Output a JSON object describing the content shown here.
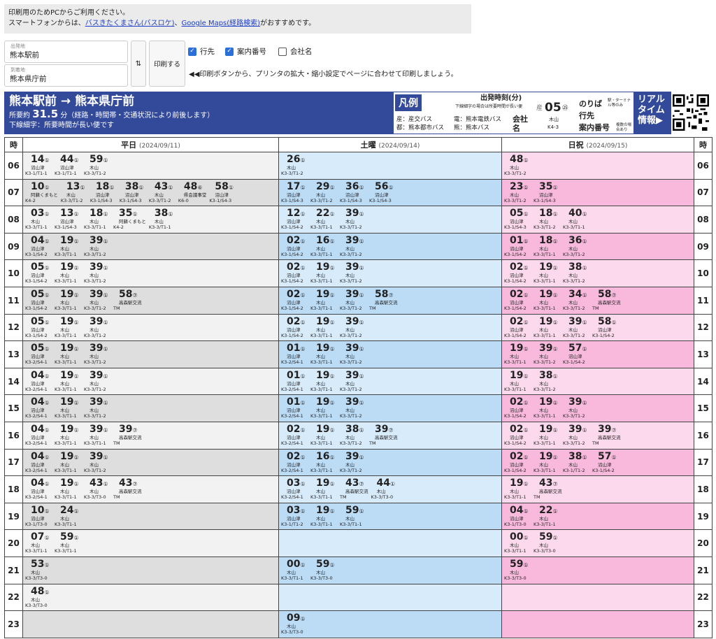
{
  "notice": {
    "line1": "印刷用のためPCからご利用ください。",
    "line2_pre": "スマートフォンからは、",
    "link1": "バスきたくまさん(バスロケ)",
    "sep": "、",
    "link2": "Google Maps(経路検索)",
    "line2_post": "がおすすめです。"
  },
  "from": {
    "label": "出発地",
    "value": "熊本駅前"
  },
  "to": {
    "label": "到着地",
    "value": "熊本県庁前"
  },
  "swap_label": "⇅",
  "print_label": "印刷する",
  "options": [
    {
      "label": "行先",
      "checked": true
    },
    {
      "label": "案内番号",
      "checked": true
    },
    {
      "label": "会社名",
      "checked": false
    }
  ],
  "hint": "◀◀印刷ボタンから、プリンタの拡大・縮小設定でページに合わせて印刷しましょう。",
  "route": {
    "title": "熊本駅前 → 熊本県庁前",
    "dur_pre": "所要約",
    "dur_val": "31.5",
    "dur_post": "分（経路・時間帯・交通状況により前後します）",
    "note": "下線細字：所要時間が長い便です"
  },
  "legend": {
    "tag": "凡例",
    "company1": "産：産交バス",
    "company2": "都：熊本都市バス",
    "company3": "電：熊本電鉄バス",
    "company4": "熊：熊本バス",
    "departure": "出発時刻(分)",
    "departure_note": "下線細字の場合は所要時間が長い便",
    "sample_co": "産",
    "sample_min": "05",
    "sample_stop": "㉕",
    "sample_dest": "木山",
    "sample_code": "K4-3",
    "k_company": "会社名",
    "k_stop": "のりば",
    "k_stop_note": "駅・ターミナル等のみ",
    "k_dest": "行先",
    "k_code": "案内番号",
    "k_code_note": "複数の場合あり"
  },
  "realtime": "リアルタイム情報▶",
  "headers": {
    "hour": "時",
    "weekday": "平日",
    "weekday_date": "(2024/09/11)",
    "saturday": "土曜",
    "saturday_date": "(2024/09/14)",
    "holiday": "日祝",
    "holiday_date": "(2024/09/15)"
  },
  "rows": [
    {
      "h": "06",
      "wd": [
        [
          "14",
          "①",
          "沼山津",
          "K3-1/T1-1"
        ],
        [
          "44",
          "①",
          "沼山津",
          "K3-1/T1-1"
        ],
        [
          "59",
          "①",
          "木山",
          "K3-3/T1-2"
        ]
      ],
      "sa": [
        [
          "26",
          "①",
          "木山",
          "K3-3/T1-2"
        ]
      ],
      "ho": [
        [
          "48",
          "①",
          "木山",
          "K3-3/T1-2"
        ]
      ]
    },
    {
      "h": "07",
      "wd": [
        [
          "10",
          "①",
          "阿蘇くまもと",
          "K4-2"
        ],
        [
          "13",
          "①",
          "木山",
          "K3-3/T1-2"
        ],
        [
          "18",
          "①",
          "沼山津",
          "K3-1/S4-3"
        ],
        [
          "38",
          "①",
          "沼山津",
          "K3-1/S4-3"
        ],
        [
          "43",
          "①",
          "木山",
          "K3-3/T1-2"
        ],
        [
          "48",
          "⑥",
          "県会議事堂",
          "K6-0"
        ],
        [
          "58",
          "①",
          "沼山津",
          "K3-1/S4-3"
        ]
      ],
      "sa": [
        [
          "17",
          "①",
          "沼山津",
          "K3-1/S4-3"
        ],
        [
          "29",
          "①",
          "木山",
          "K3-3/T1-2"
        ],
        [
          "36",
          "①",
          "沼山津",
          "K3-1/S4-3"
        ],
        [
          "56",
          "①",
          "沼山津",
          "K3-1/S4-3"
        ]
      ],
      "ho": [
        [
          "23",
          "①",
          "木山",
          "K3-3/T1-2"
        ],
        [
          "35",
          "①",
          "沼山津",
          "K3-1/S4-3"
        ]
      ]
    },
    {
      "h": "08",
      "wd": [
        [
          "03",
          "①",
          "木山",
          "K3-3/T1-1"
        ],
        [
          "13",
          "①",
          "沼山津",
          "K3-1/S4-3"
        ],
        [
          "18",
          "①",
          "木山",
          "K3-3/T1-1"
        ],
        [
          "35",
          "①",
          "阿蘇くまもと",
          "K4-2"
        ],
        [
          "38",
          "①",
          "木山",
          "K3-3/T1-1"
        ]
      ],
      "sa": [
        [
          "12",
          "①",
          "沼山津",
          "K3-1/S4-2"
        ],
        [
          "22",
          "①",
          "木山",
          "K3-3/T1-1"
        ],
        [
          "39",
          "①",
          "木山",
          "K3-3/T1-2"
        ]
      ],
      "ho": [
        [
          "05",
          "①",
          "沼山津",
          "K3-1/S4-3"
        ],
        [
          "18",
          "①",
          "木山",
          "K3-3/T1-2"
        ],
        [
          "40",
          "①",
          "木山",
          "K3-3/T1-1"
        ]
      ]
    },
    {
      "h": "09",
      "wd": [
        [
          "04",
          "①",
          "沼山津",
          "K3-1/S4-2"
        ],
        [
          "19",
          "①",
          "木山",
          "K3-3/T1-1"
        ],
        [
          "39",
          "①",
          "木山",
          "K3-3/T1-2"
        ]
      ],
      "sa": [
        [
          "02",
          "①",
          "沼山津",
          "K3-1/S4-2"
        ],
        [
          "16",
          "①",
          "木山",
          "K3-3/T1-1"
        ],
        [
          "39",
          "①",
          "木山",
          "K3-3/T1-2"
        ]
      ],
      "ho": [
        [
          "01",
          "①",
          "沼山津",
          "K3-1/S4-2"
        ],
        [
          "18",
          "①",
          "木山",
          "K3-3/T1-1"
        ],
        [
          "36",
          "①",
          "木山",
          "K3-3/T1-2"
        ]
      ]
    },
    {
      "h": "10",
      "wd": [
        [
          "05",
          "①",
          "沼山津",
          "K3-1/S4-2"
        ],
        [
          "19",
          "①",
          "木山",
          "K3-3/T1-1"
        ],
        [
          "39",
          "①",
          "木山",
          "K3-3/T1-2"
        ]
      ],
      "sa": [
        [
          "02",
          "①",
          "沼山津",
          "K3-1/S4-2"
        ],
        [
          "19",
          "①",
          "木山",
          "K3-3/T1-1"
        ],
        [
          "39",
          "①",
          "木山",
          "K3-3/T1-2"
        ]
      ],
      "ho": [
        [
          "02",
          "①",
          "沼山津",
          "K3-1/S4-2"
        ],
        [
          "19",
          "①",
          "木山",
          "K3-3/T1-1"
        ],
        [
          "38",
          "①",
          "木山",
          "K3-3/T1-2"
        ]
      ]
    },
    {
      "h": "11",
      "wd": [
        [
          "05",
          "①",
          "沼山津",
          "K3-1/S4-2"
        ],
        [
          "19",
          "①",
          "木山",
          "K3-3/T1-1"
        ],
        [
          "39",
          "①",
          "木山",
          "K3-3/T1-2"
        ],
        [
          "58",
          "⑦",
          "高森駅交流",
          "TM"
        ]
      ],
      "sa": [
        [
          "02",
          "①",
          "沼山津",
          "K3-1/S4-2"
        ],
        [
          "19",
          "①",
          "木山",
          "K3-3/T1-1"
        ],
        [
          "39",
          "①",
          "木山",
          "K3-3/T1-2"
        ],
        [
          "58",
          "⑦",
          "高森駅交流",
          "TM"
        ]
      ],
      "ho": [
        [
          "02",
          "①",
          "沼山津",
          "K3-1/S4-2"
        ],
        [
          "19",
          "①",
          "木山",
          "K3-3/T1-1"
        ],
        [
          "34",
          "①",
          "木山",
          "K3-3/T1-2"
        ],
        [
          "58",
          "⑦",
          "高森駅交流",
          "TM"
        ]
      ]
    },
    {
      "h": "12",
      "wd": [
        [
          "05",
          "①",
          "沼山津",
          "K3-1/S4-2"
        ],
        [
          "19",
          "①",
          "木山",
          "K3-3/T1-1"
        ],
        [
          "39",
          "①",
          "木山",
          "K3-3/T1-2"
        ]
      ],
      "sa": [
        [
          "02",
          "①",
          "沼山津",
          "K3-1/S4-2"
        ],
        [
          "19",
          "①",
          "木山",
          "K3-3/T1-1"
        ],
        [
          "39",
          "①",
          "木山",
          "K3-3/T1-2"
        ]
      ],
      "ho": [
        [
          "02",
          "①",
          "沼山津",
          "K3-1/S4-2"
        ],
        [
          "19",
          "①",
          "木山",
          "K3-3/T1-1"
        ],
        [
          "39",
          "①",
          "木山",
          "K3-3/T1-2"
        ],
        [
          "58",
          "①",
          "沼山津",
          "K3-1/S4-2"
        ]
      ]
    },
    {
      "h": "13",
      "wd": [
        [
          "05",
          "①",
          "沼山津",
          "K3-2/S4-1"
        ],
        [
          "19",
          "①",
          "木山",
          "K3-3/T1-1"
        ],
        [
          "39",
          "①",
          "木山",
          "K3-3/T1-2"
        ]
      ],
      "sa": [
        [
          "01",
          "①",
          "沼山津",
          "K3-2/S4-1"
        ],
        [
          "19",
          "①",
          "木山",
          "K3-3/T1-1"
        ],
        [
          "39",
          "①",
          "木山",
          "K3-3/T1-2"
        ]
      ],
      "ho": [
        [
          "19",
          "①",
          "木山",
          "K3-3/T1-1"
        ],
        [
          "39",
          "①",
          "木山",
          "K3-3/T1-2"
        ],
        [
          "57",
          "①",
          "沼山津",
          "K3-1/S4-2"
        ]
      ]
    },
    {
      "h": "14",
      "wd": [
        [
          "04",
          "①",
          "沼山津",
          "K3-2/S4-1"
        ],
        [
          "19",
          "①",
          "木山",
          "K3-3/T1-1"
        ],
        [
          "39",
          "①",
          "木山",
          "K3-3/T1-2"
        ]
      ],
      "sa": [
        [
          "01",
          "①",
          "沼山津",
          "K3-2/S4-1"
        ],
        [
          "19",
          "①",
          "木山",
          "K3-3/T1-1"
        ],
        [
          "39",
          "①",
          "木山",
          "K3-3/T1-2"
        ]
      ],
      "ho": [
        [
          "19",
          "①",
          "木山",
          "K3-3/T1-1"
        ],
        [
          "38",
          "①",
          "木山",
          "K3-3/T1-2"
        ]
      ]
    },
    {
      "h": "15",
      "wd": [
        [
          "04",
          "①",
          "沼山津",
          "K3-2/S4-1"
        ],
        [
          "19",
          "①",
          "木山",
          "K3-3/T1-1"
        ],
        [
          "39",
          "①",
          "木山",
          "K3-3/T1-2"
        ]
      ],
      "sa": [
        [
          "01",
          "①",
          "沼山津",
          "K3-2/S4-1"
        ],
        [
          "19",
          "①",
          "木山",
          "K3-3/T1-1"
        ],
        [
          "39",
          "①",
          "木山",
          "K3-3/T1-2"
        ]
      ],
      "ho": [
        [
          "02",
          "①",
          "沼山津",
          "K3-1/S4-2"
        ],
        [
          "19",
          "①",
          "木山",
          "K3-3/T1-1"
        ],
        [
          "39",
          "①",
          "木山",
          "K3-3/T1-2"
        ]
      ]
    },
    {
      "h": "16",
      "wd": [
        [
          "04",
          "①",
          "沼山津",
          "K3-2/S4-1"
        ],
        [
          "19",
          "①",
          "木山",
          "K3-3/T1-1"
        ],
        [
          "39",
          "①",
          "木山",
          "K3-3/T1-1"
        ],
        [
          "39",
          "⑦",
          "高森駅交流",
          "TM"
        ]
      ],
      "sa": [
        [
          "02",
          "①",
          "沼山津",
          "K3-2/S4-1"
        ],
        [
          "19",
          "①",
          "木山",
          "K3-3/T1-1"
        ],
        [
          "38",
          "①",
          "木山",
          "K3-3/T1-2"
        ],
        [
          "39",
          "⑦",
          "高森駅交流",
          "TM"
        ]
      ],
      "ho": [
        [
          "02",
          "①",
          "沼山津",
          "K3-1/S4-2"
        ],
        [
          "19",
          "①",
          "木山",
          "K3-3/T1-1"
        ],
        [
          "39",
          "①",
          "木山",
          "K3-3/T1-2"
        ],
        [
          "39",
          "⑦",
          "高森駅交流",
          "TM"
        ]
      ]
    },
    {
      "h": "17",
      "wd": [
        [
          "04",
          "①",
          "沼山津",
          "K3-2/S4-1"
        ],
        [
          "19",
          "①",
          "木山",
          "K3-3/T1-1"
        ],
        [
          "39",
          "①",
          "木山",
          "K3-3/T1-2"
        ]
      ],
      "sa": [
        [
          "02",
          "①",
          "沼山津",
          "K3-2/S4-1"
        ],
        [
          "16",
          "①",
          "木山",
          "K3-3/T1-1"
        ],
        [
          "39",
          "①",
          "木山",
          "K3-3/T1-2"
        ]
      ],
      "ho": [
        [
          "02",
          "①",
          "沼山津",
          "K3-1/S4-2"
        ],
        [
          "19",
          "①",
          "木山",
          "K3-3/T1-1"
        ],
        [
          "38",
          "①",
          "木山",
          "K3-1/T1-2"
        ],
        [
          "57",
          "①",
          "沼山津",
          "K3-1/S4-2"
        ]
      ]
    },
    {
      "h": "18",
      "wd": [
        [
          "04",
          "①",
          "沼山津",
          "K3-2/S4-1"
        ],
        [
          "19",
          "①",
          "木山",
          "K3-3/T1-1"
        ],
        [
          "43",
          "①",
          "木山",
          "K3-3/T3-0"
        ],
        [
          "43",
          "⑦",
          "高森駅交流",
          "TM"
        ]
      ],
      "sa": [
        [
          "03",
          "①",
          "沼山津",
          "K3-2/S4-1"
        ],
        [
          "19",
          "①",
          "木山",
          "K3-3/T1-1"
        ],
        [
          "43",
          "⑦",
          "高森駅交流",
          "TM"
        ],
        [
          "44",
          "①",
          "木山",
          "K3-3/T3-0"
        ]
      ],
      "ho": [
        [
          "19",
          "①",
          "木山",
          "K3-3/T1-1"
        ],
        [
          "43",
          "⑦",
          "高森駅交流",
          "TM"
        ]
      ]
    },
    {
      "h": "19",
      "wd": [
        [
          "10",
          "①",
          "沼山津",
          "K3-1/T3-0"
        ],
        [
          "24",
          "①",
          "木山",
          "K3-3/T1-1"
        ]
      ],
      "sa": [
        [
          "03",
          "①",
          "沼山津",
          "K3-1/T1-2"
        ],
        [
          "19",
          "①",
          "木山",
          "K3-3/T1-1"
        ],
        [
          "59",
          "①",
          "木山",
          "K3-3/T1-1"
        ]
      ],
      "ho": [
        [
          "04",
          "①",
          "沼山津",
          "K3-1/T3-0"
        ],
        [
          "22",
          "①",
          "木山",
          "K3-3/T1-1"
        ]
      ]
    },
    {
      "h": "20",
      "wd": [
        [
          "07",
          "①",
          "木山",
          "K3-3/T1-1"
        ],
        [
          "59",
          "①",
          "木山",
          "K3-3/T1-1"
        ]
      ],
      "sa": [],
      "ho": [
        [
          "00",
          "①",
          "木山",
          "K3-3/T1-1"
        ],
        [
          "59",
          "①",
          "木山",
          "K3-3/T3-0"
        ]
      ]
    },
    {
      "h": "21",
      "wd": [
        [
          "53",
          "①",
          "木山",
          "K3-3/T3-0"
        ]
      ],
      "sa": [
        [
          "00",
          "①",
          "木山",
          "K3-3/T1-1"
        ],
        [
          "59",
          "①",
          "木山",
          "K3-3/T3-0"
        ]
      ],
      "ho": [
        [
          "59",
          "①",
          "木山",
          "K3-3/T3-0"
        ]
      ]
    },
    {
      "h": "22",
      "wd": [
        [
          "48",
          "①",
          "木山",
          "K3-3/T3-0"
        ]
      ],
      "sa": [],
      "ho": []
    },
    {
      "h": "23",
      "wd": [],
      "sa": [
        [
          "09",
          "①",
          "木山",
          "K3-3/T3-0"
        ]
      ],
      "ho": []
    }
  ]
}
